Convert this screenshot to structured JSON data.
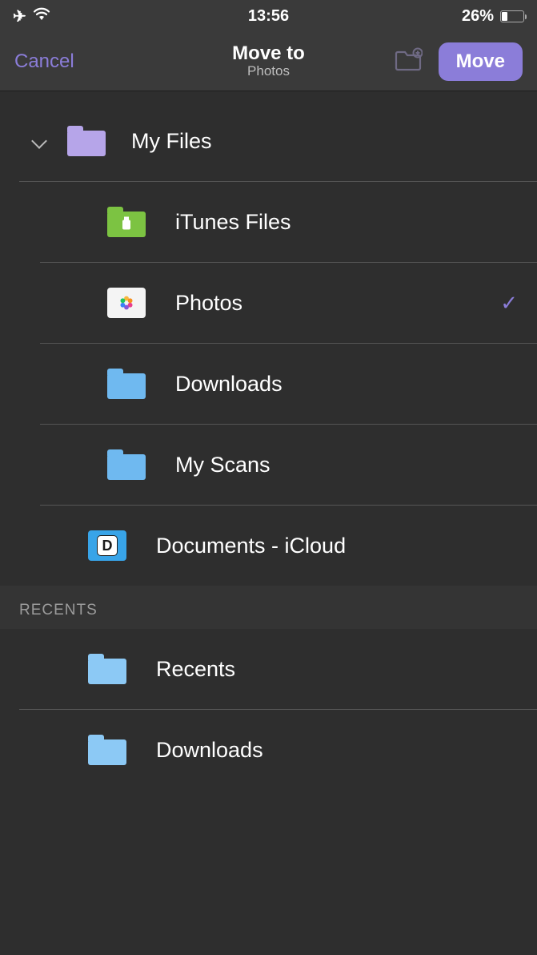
{
  "status": {
    "time": "13:56",
    "battery_percent": "26%"
  },
  "nav": {
    "cancel": "Cancel",
    "title": "Move to",
    "subtitle": "Photos",
    "move": "Move"
  },
  "tree": {
    "root": {
      "label": "My Files",
      "icon": "folder-purple"
    },
    "children": [
      {
        "label": "iTunes Files",
        "icon": "folder-green",
        "selected": false
      },
      {
        "label": "Photos",
        "icon": "photos",
        "selected": true
      },
      {
        "label": "Downloads",
        "icon": "folder-blue",
        "selected": false
      },
      {
        "label": "My Scans",
        "icon": "folder-blue",
        "selected": false
      }
    ],
    "icloud": {
      "label": "Documents - iCloud",
      "icon": "icloud-doc"
    }
  },
  "sections": {
    "recents_header": "RECENTS",
    "recents": [
      {
        "label": "Recents",
        "icon": "folder-lightblue"
      },
      {
        "label": "Downloads",
        "icon": "folder-lightblue"
      }
    ]
  }
}
